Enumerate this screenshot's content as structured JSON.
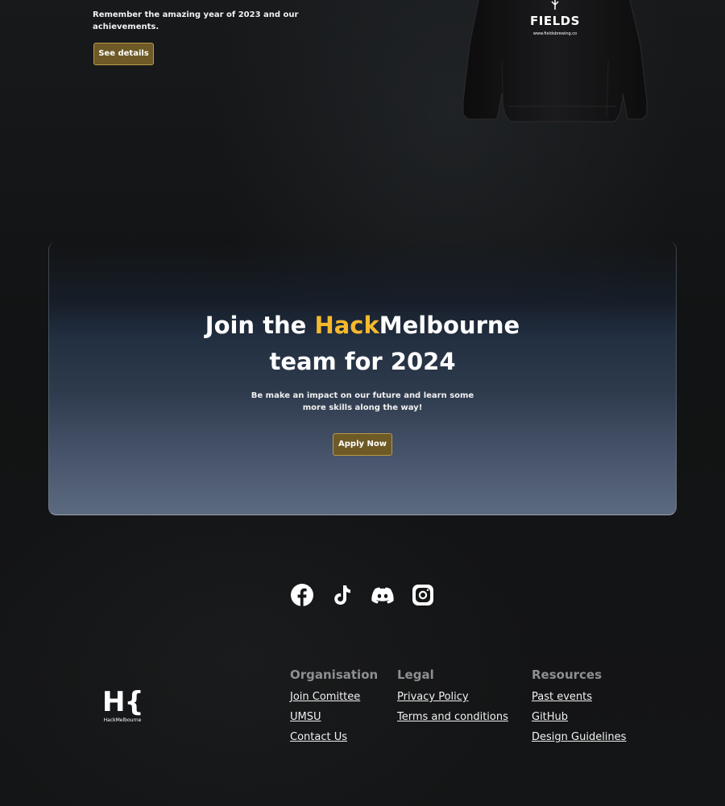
{
  "hero": {
    "description": "Remember the amazing year of 2023 and our achievements.",
    "see_details_label": "See details",
    "hoodie": {
      "brand": "FIELDS",
      "url": "www.fieldsbrewing.co"
    }
  },
  "cta": {
    "title_prefix": "Join the ",
    "title_accent": "Hack",
    "title_suffix": "Melbourne",
    "title_line2": "team for 2024",
    "subtitle": "Be make an impact on our future and learn some more skills along the way!",
    "apply_label": "Apply Now",
    "accent_color": "#f6b92d",
    "button_color": "#6e5a26"
  },
  "social": [
    {
      "icon": "facebook-icon"
    },
    {
      "icon": "tiktok-icon"
    },
    {
      "icon": "discord-icon"
    },
    {
      "icon": "instagram-icon"
    }
  ],
  "footer": {
    "logo": {
      "letters": "H{",
      "wordmark": "HackMelbourne"
    },
    "columns": [
      {
        "heading": "Organisation",
        "links": [
          "Join Comittee",
          "UMSU",
          "Contact Us"
        ]
      },
      {
        "heading": "Legal",
        "links": [
          "Privacy Policy",
          "Terms and conditions"
        ]
      },
      {
        "heading": "Resources",
        "links": [
          "Past events",
          "GitHub",
          "Design Guidelines"
        ]
      }
    ]
  }
}
